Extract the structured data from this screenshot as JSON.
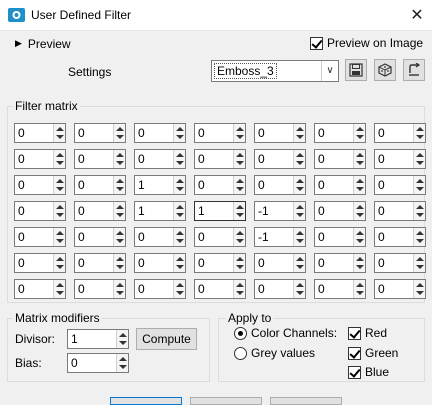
{
  "window": {
    "title": "User Defined Filter",
    "close_glyph": "✕"
  },
  "preview": {
    "toggle_label": "Preview",
    "toggle_glyph": "▶",
    "on_image_label": "Preview on Image",
    "on_image_checked": true
  },
  "settings": {
    "label": "Settings",
    "preset_value": "Emboss_3",
    "dropdown_glyph": "∨",
    "toolbar_icons": [
      "save-icon",
      "randomize-icon",
      "reset-icon"
    ]
  },
  "filter_matrix": {
    "label": "Filter matrix",
    "rows": [
      [
        "0",
        "0",
        "0",
        "0",
        "0",
        "0",
        "0"
      ],
      [
        "0",
        "0",
        "0",
        "0",
        "0",
        "0",
        "0"
      ],
      [
        "0",
        "0",
        "1",
        "0",
        "0",
        "0",
        "0"
      ],
      [
        "0",
        "0",
        "1",
        "1",
        "-1",
        "0",
        "0"
      ],
      [
        "0",
        "0",
        "0",
        "0",
        "-1",
        "0",
        "0"
      ],
      [
        "0",
        "0",
        "0",
        "0",
        "0",
        "0",
        "0"
      ],
      [
        "0",
        "0",
        "0",
        "0",
        "0",
        "0",
        "0"
      ]
    ]
  },
  "matrix_modifiers": {
    "label": "Matrix modifiers",
    "divisor_label": "Divisor:",
    "divisor_value": "1",
    "bias_label": "Bias:",
    "bias_value": "0",
    "compute_label": "Compute"
  },
  "apply_to": {
    "label": "Apply to",
    "color_channels_label": "Color Channels:",
    "grey_values_label": "Grey values",
    "selected": "color_channels",
    "red_label": "Red",
    "green_label": "Green",
    "blue_label": "Blue",
    "red_checked": true,
    "green_checked": true,
    "blue_checked": true
  }
}
